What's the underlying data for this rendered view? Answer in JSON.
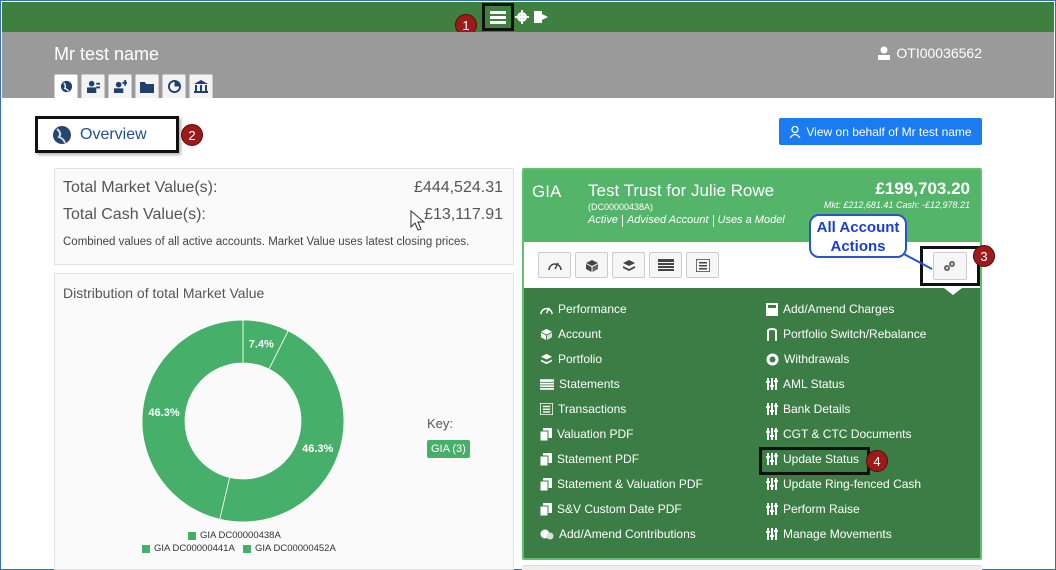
{
  "header": {
    "client_name": "Mr test name",
    "client_id": "OTI00036562"
  },
  "overview": {
    "title": "Overview"
  },
  "view_button": {
    "label": "View on behalf of Mr test name"
  },
  "totals": {
    "market_label": "Total Market Value(s):",
    "market_value": "£444,524.31",
    "cash_label": "Total Cash Value(s):",
    "cash_value": "£13,117.91",
    "note": "Combined values of all active accounts. Market Value uses latest closing prices."
  },
  "distribution": {
    "title": "Distribution of total Market Value",
    "key_label": "Key:",
    "key_chip": "GIA (3)"
  },
  "chart_data": {
    "type": "pie",
    "donut": true,
    "categories": [
      "GIA DC00000438A",
      "GIA DC00000441A",
      "GIA DC00000452A"
    ],
    "values": [
      7.4,
      46.3,
      46.3
    ],
    "labels": [
      "7.4%",
      "46.3%",
      "46.3%"
    ],
    "colors": [
      "#46b06a",
      "#46b06a",
      "#46b06a"
    ],
    "legend_placement": "bottom"
  },
  "account": {
    "type": "GIA",
    "name": "Test Trust for Julie Rowe",
    "id": "(DC00000438A)",
    "tags": [
      "Active",
      "Advised Account",
      "Uses a Model"
    ],
    "amount": "£199,703.20",
    "mkt_cash": "Mkt: £212,681.41  Cash: -£12,978.21",
    "callout": "All Account Actions",
    "actions_left": [
      "Performance",
      "Account",
      "Portfolio",
      "Statements",
      "Transactions",
      "Valuation PDF",
      "Statement PDF",
      "Statement & Valuation PDF",
      "S&V Custom Date PDF",
      "Add/Amend Contributions"
    ],
    "actions_right": [
      "Add/Amend Charges",
      "Portfolio Switch/Rebalance",
      "Withdrawals",
      "AML Status",
      "Bank Details",
      "CGT & CTC Documents",
      "Update Status",
      "Update Ring-fenced Cash",
      "Perform Raise",
      "Manage Movements"
    ]
  },
  "badges": [
    "1",
    "2",
    "3",
    "4"
  ],
  "colors": {
    "topbar": "#3f7f3f",
    "accent_green": "#54b56a",
    "button_blue": "#1a7cf0",
    "badge_red": "#9b1b1b"
  }
}
